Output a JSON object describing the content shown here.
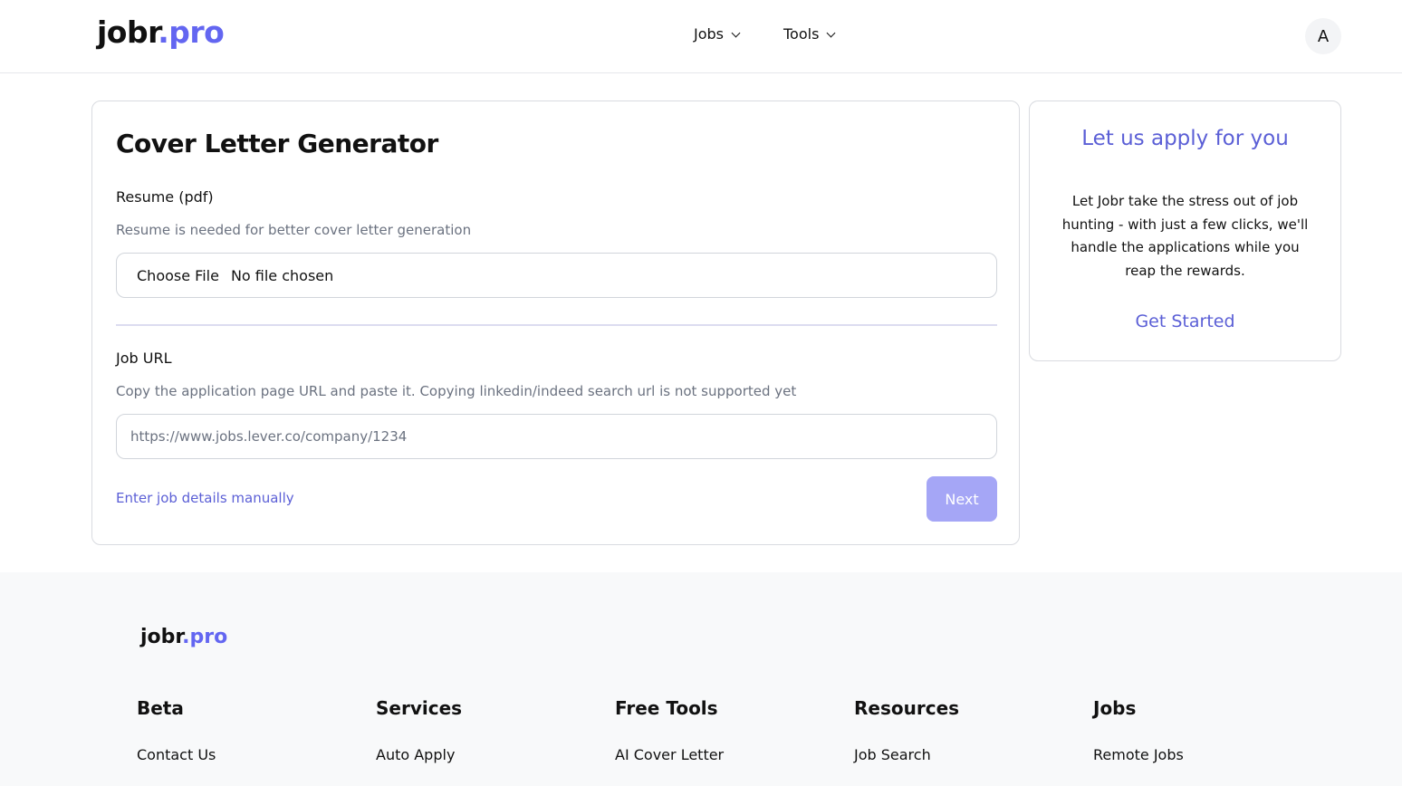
{
  "header": {
    "logo_main": "jobr",
    "logo_accent": ".pro",
    "nav": [
      {
        "label": "Jobs"
      },
      {
        "label": "Tools"
      }
    ],
    "avatar_initial": "A"
  },
  "main": {
    "title": "Cover Letter Generator",
    "resume_label": "Resume (pdf)",
    "resume_help": "Resume is needed for better cover letter generation",
    "file_button": "Choose File",
    "file_status": "No file chosen",
    "job_url_label": "Job URL",
    "job_url_help": "Copy the application page URL and paste it. Copying linkedin/indeed search url is not supported yet",
    "job_url_placeholder": "https://www.jobs.lever.co/company/1234",
    "manual_link": "Enter job details manually",
    "next_button": "Next"
  },
  "side": {
    "title": "Let us apply for you",
    "body": "Let Jobr take the stress out of job hunting - with just a few clicks, we'll handle the applications while you reap the rewards.",
    "cta": "Get Started"
  },
  "footer": {
    "logo_main": "jobr",
    "logo_accent": ".pro",
    "columns": [
      {
        "heading": "Beta",
        "link": "Contact Us"
      },
      {
        "heading": "Services",
        "link": "Auto Apply"
      },
      {
        "heading": "Free Tools",
        "link": "AI Cover Letter"
      },
      {
        "heading": "Resources",
        "link": "Job Search"
      },
      {
        "heading": "Jobs",
        "link": "Remote Jobs"
      }
    ]
  },
  "colors": {
    "accent": "#6366f1",
    "link": "#5b5fd6",
    "button_disabled": "#a5a6f6"
  }
}
